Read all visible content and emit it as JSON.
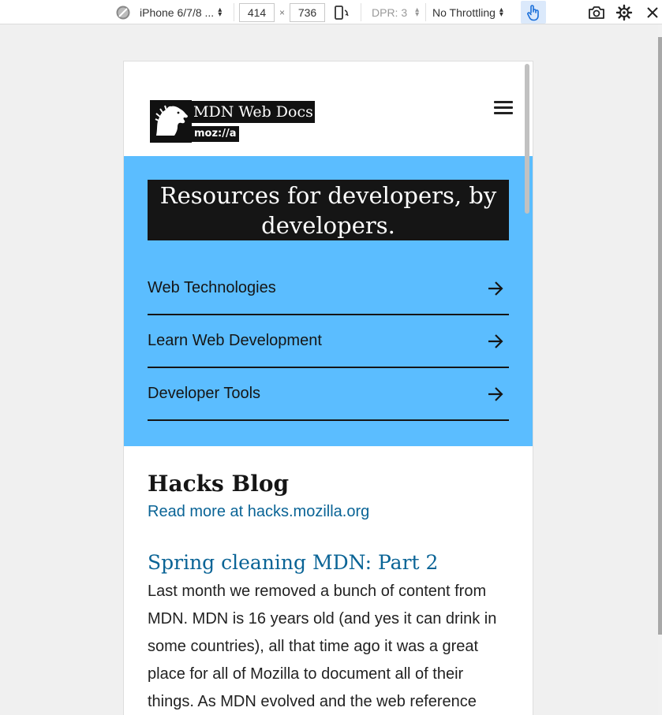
{
  "devtools": {
    "device": "iPhone 6/7/8 ...",
    "width": "414",
    "times": "×",
    "height": "736",
    "dpr": "DPR: 3",
    "throttling": "No Throttling"
  },
  "header": {
    "logo_title": "MDN Web Docs",
    "logo_sub": "moz://a"
  },
  "hero": {
    "tagline": "Resources for developers, by developers.",
    "links": [
      "Web Technologies",
      "Learn Web Development",
      "Developer Tools"
    ]
  },
  "blog": {
    "title": "Hacks Blog",
    "link": "Read more at hacks.mozilla.org",
    "post_title": "Spring cleaning MDN: Part 2",
    "post_body": "Last month we removed a bunch of content from MDN. MDN is 16 years old (and yes it can drink in some countries), all that time ago it was a great place for all of Mozilla to document all of their things. As MDN evolved and the web reference"
  },
  "colors": {
    "hero_bg": "#5bbdff",
    "link": "#0a6496",
    "dark": "#151515"
  }
}
